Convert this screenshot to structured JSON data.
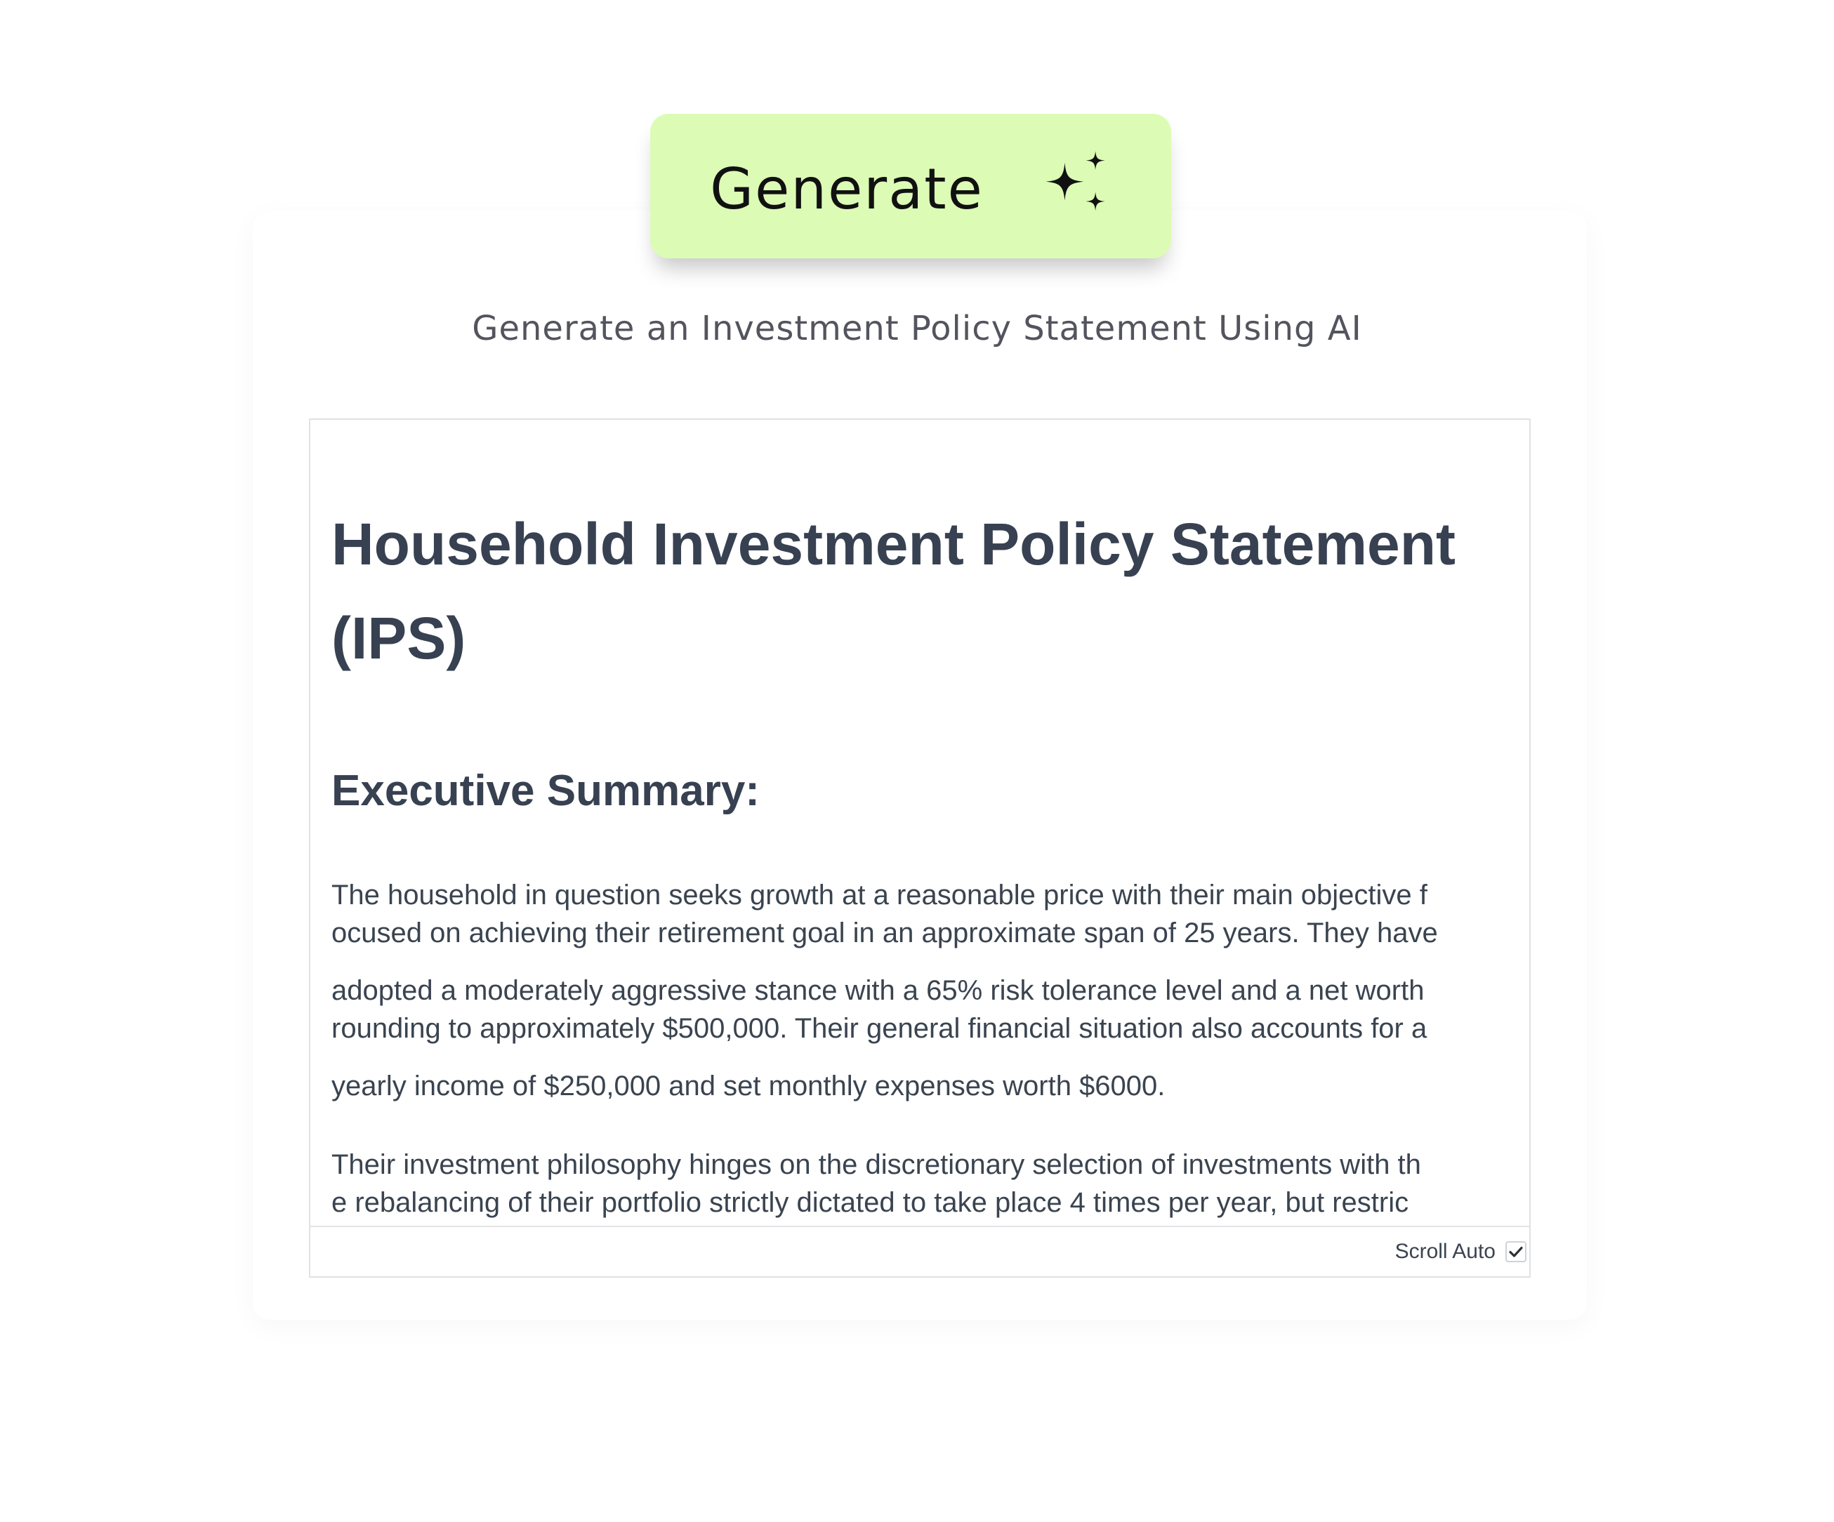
{
  "generate_button": {
    "label": "Generate",
    "icon": "sparkles-icon",
    "background": "#dcfcb6"
  },
  "subtitle": "Generate an Investment Policy Statement Using AI",
  "document": {
    "title": "Household Investment Policy Statement\n(IPS)",
    "section_heading": "Executive Summary:",
    "paragraph_lines": [
      "The household in question seeks growth at a reasonable price with their main objective f",
      "ocused on achieving their retirement goal in an approximate span of 25 years. They have",
      "adopted a moderately aggressive stance with a 65% risk tolerance level and a net worth",
      "rounding to approximately $500,000. Their general financial situation also accounts for a",
      "yearly income of $250,000 and set monthly expenses worth $6000.",
      "Their investment philosophy hinges on the discretionary selection of investments with th",
      "e rebalancing of their portfolio strictly dictated to take place 4 times per year, but restric"
    ]
  },
  "footer": {
    "scroll_auto_label": "Scroll Auto",
    "scroll_auto_checked": true
  }
}
